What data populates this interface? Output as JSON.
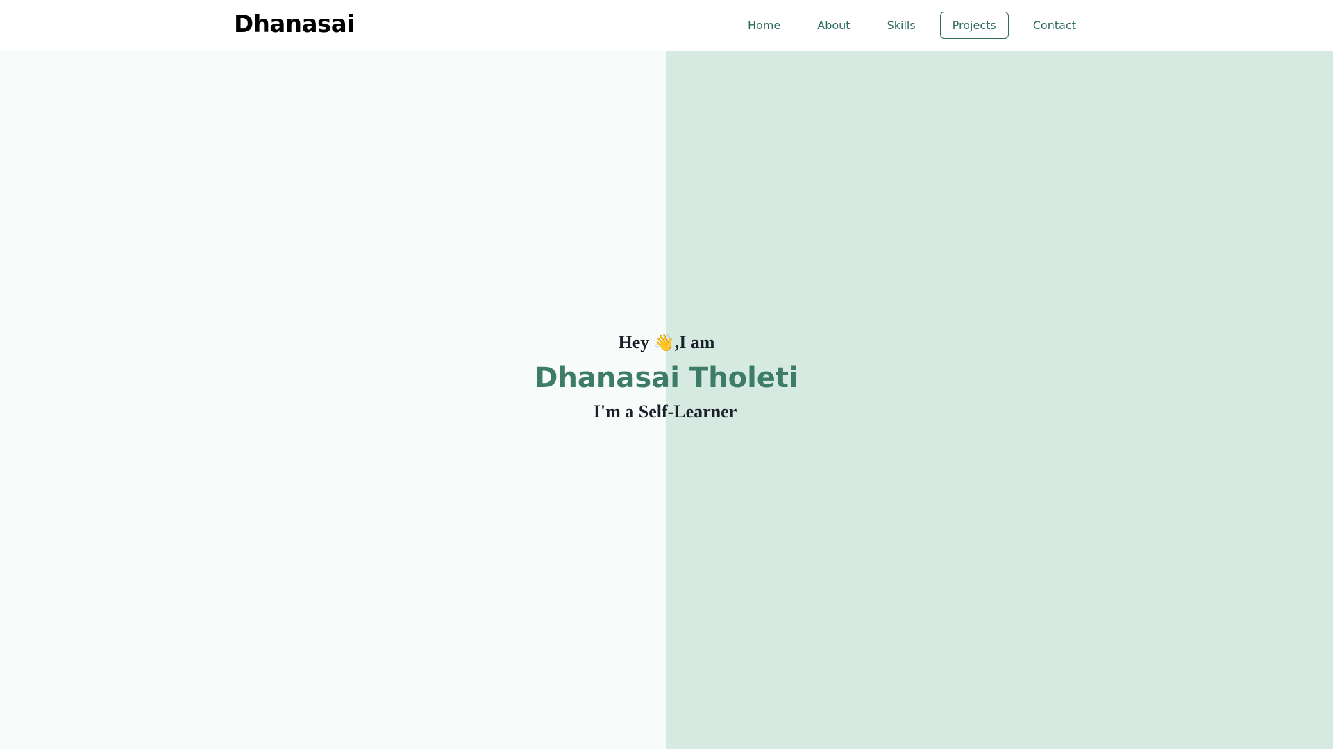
{
  "navbar": {
    "brand": "Dhanasai",
    "links": [
      {
        "label": "Home",
        "active": false
      },
      {
        "label": "About",
        "active": false
      },
      {
        "label": "Skills",
        "active": false
      },
      {
        "label": "Projects",
        "active": true
      },
      {
        "label": "Contact",
        "active": false
      }
    ]
  },
  "hero": {
    "greeting_prefix": "Hey ",
    "greeting_icon": "waving-hand-icon",
    "greeting_suffix": ",I am",
    "name": "Dhanasai Tholeti",
    "tagline": "I'm a Self-Learner"
  },
  "colors": {
    "accent": "#3d7d68",
    "nav_text": "#2e6b60",
    "left_bg": "#f7fcfb",
    "right_bg": "#d6eae1",
    "heading_text": "#1b1f2a"
  }
}
